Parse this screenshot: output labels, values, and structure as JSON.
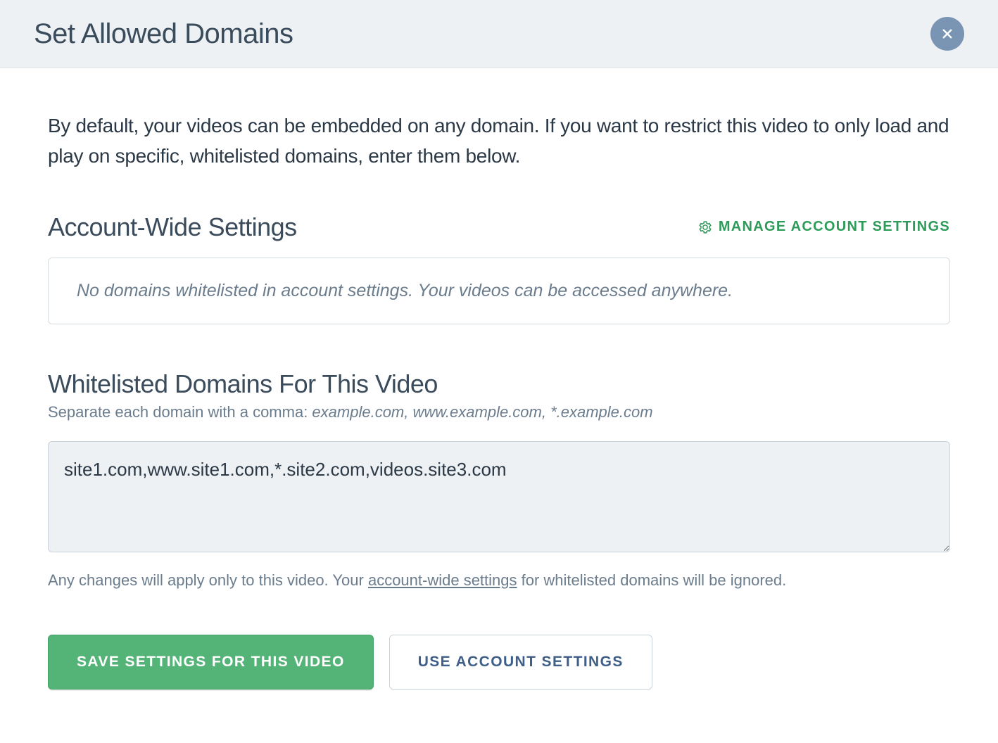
{
  "header": {
    "title": "Set Allowed Domains"
  },
  "intro": "By default, your videos can be embedded on any domain. If you want to restrict this video to only load and play on specific, whitelisted domains, enter them below.",
  "account_section": {
    "heading": "Account-Wide Settings",
    "manage_label": "MANAGE ACCOUNT SETTINGS",
    "empty_message": "No domains whitelisted in account settings. Your videos can be accessed anywhere."
  },
  "video_section": {
    "heading": "Whitelisted Domains For This Video",
    "sub_prefix": "Separate each domain with a comma: ",
    "sub_example": "example.com, www.example.com, *.example.com",
    "textarea_value": "site1.com,www.site1.com,*.site2.com,videos.site3.com",
    "note_prefix": "Any changes will apply only to this video. Your ",
    "note_link": "account-wide settings",
    "note_suffix": " for whitelisted domains will be ignored."
  },
  "buttons": {
    "save": "SAVE SETTINGS FOR THIS VIDEO",
    "use_account": "USE ACCOUNT SETTINGS"
  }
}
